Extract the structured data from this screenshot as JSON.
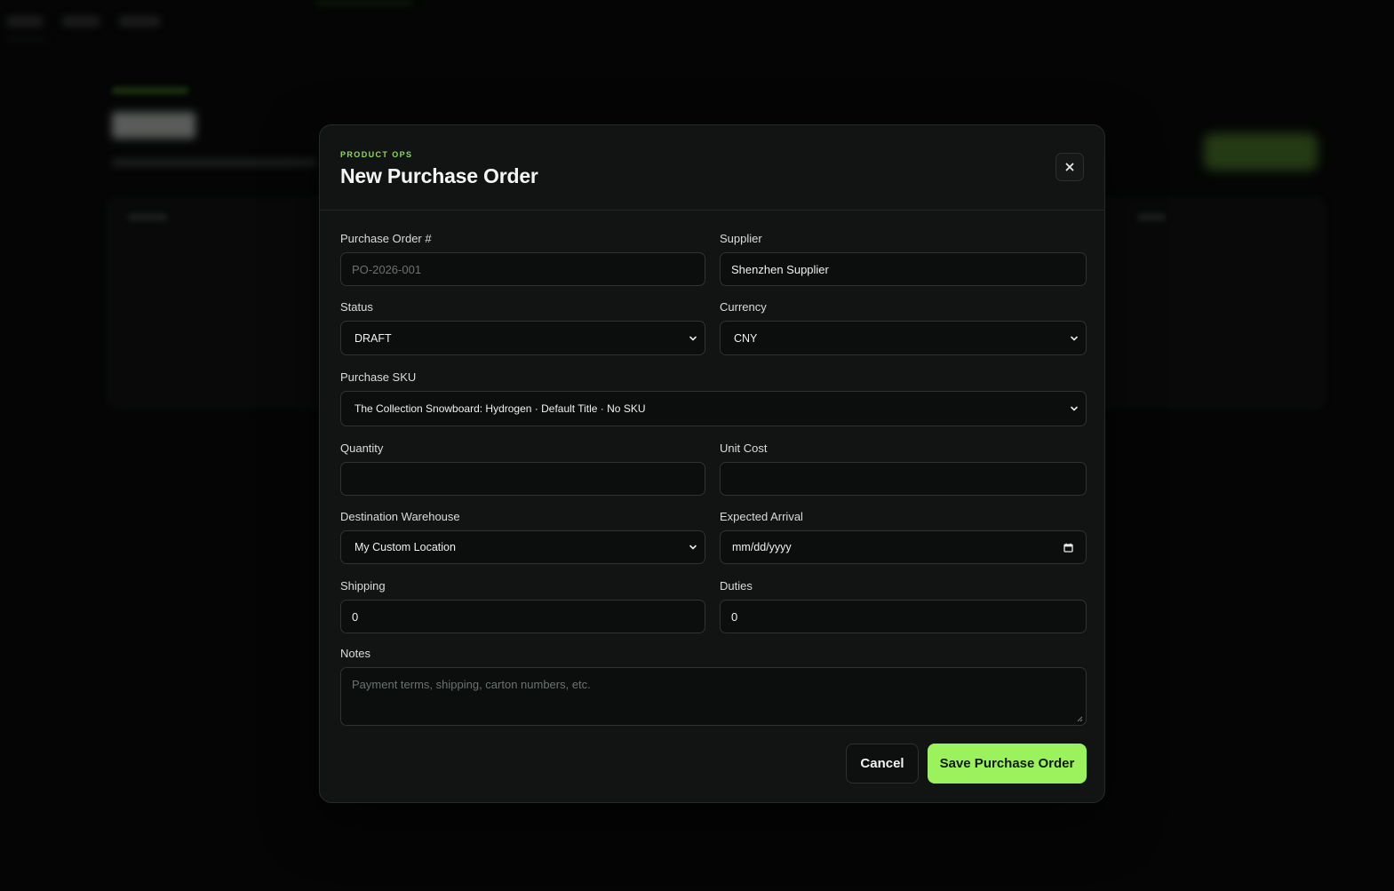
{
  "modal": {
    "eyebrow": "PRODUCT OPS",
    "title": "New Purchase Order"
  },
  "fields": {
    "po_number": {
      "label": "Purchase Order #",
      "value": "",
      "placeholder": "PO-2026-001"
    },
    "supplier": {
      "label": "Supplier",
      "value": "Shenzhen Supplier"
    },
    "status": {
      "label": "Status",
      "value": "DRAFT"
    },
    "currency": {
      "label": "Currency",
      "value": "CNY"
    },
    "sku": {
      "label": "Purchase SKU",
      "value": "The Collection Snowboard: Hydrogen · Default Title · No SKU"
    },
    "quantity": {
      "label": "Quantity",
      "value": ""
    },
    "unit_cost": {
      "label": "Unit Cost",
      "value": ""
    },
    "warehouse": {
      "label": "Destination Warehouse",
      "value": "My Custom Location"
    },
    "arrival": {
      "label": "Expected Arrival",
      "value": "mm/dd/yyyy"
    },
    "shipping": {
      "label": "Shipping",
      "value": "0"
    },
    "duties": {
      "label": "Duties",
      "value": "0"
    },
    "notes": {
      "label": "Notes",
      "value": "",
      "placeholder": "Payment terms, shipping, carton numbers, etc."
    }
  },
  "actions": {
    "cancel_label": "Cancel",
    "save_label": "Save Purchase Order"
  },
  "icons": {
    "close": "close-icon",
    "chevron": "chevron-down-icon",
    "calendar": "calendar-icon"
  },
  "colors": {
    "accent": "#9bf25c",
    "eyebrow": "#8bdc4f",
    "modal_bg": "#111413",
    "input_bg": "#0c0e0d"
  }
}
